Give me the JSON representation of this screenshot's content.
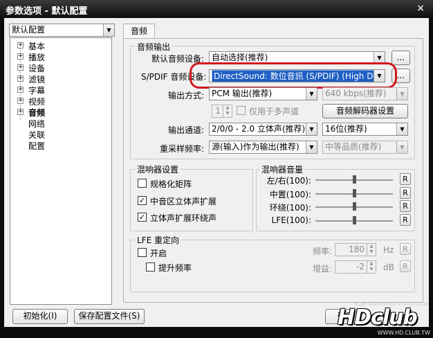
{
  "window": {
    "title": "参数选项 - 默认配置",
    "close_glyph": "×"
  },
  "profile_select": {
    "value": "默认配置"
  },
  "tree": {
    "items": [
      {
        "label": "基本",
        "expandable": true
      },
      {
        "label": "播放",
        "expandable": true
      },
      {
        "label": "设备",
        "expandable": true
      },
      {
        "label": "滤镜",
        "expandable": true
      },
      {
        "label": "字幕",
        "expandable": true
      },
      {
        "label": "视频",
        "expandable": true
      },
      {
        "label": "音频",
        "expandable": true,
        "selected": true
      },
      {
        "label": "网络",
        "expandable": false
      },
      {
        "label": "关联",
        "expandable": false
      },
      {
        "label": "配置",
        "expandable": false
      }
    ]
  },
  "tab": {
    "label": "音频"
  },
  "audio_output": {
    "group_label": "音频输出",
    "default_device_label": "默认音频设备:",
    "default_device_value": "自动选择(推荐)",
    "spdif_label": "S/PDIF 音频设备:",
    "spdif_value": "DirectSound: 数位音訊 (S/PDIF) (High Definition",
    "browse_label": "...",
    "output_mode_label": "输出方式:",
    "output_mode_value": "PCM 输出(推荐)",
    "bitrate_value": "640 kbps(推荐)",
    "spin_value": "1",
    "multichannel_only_label": "仅用于多声道",
    "decoder_button": "音频解码器设置",
    "channel_label": "输出通道:",
    "channel_value": "2/0/0 - 2.0 立体声(推荐)",
    "bits_value": "16位(推荐)",
    "resample_label": "重采样频率:",
    "resample_value": "源(输入)作为输出(推荐)",
    "quality_value": "中等品质(推荐)"
  },
  "mixer_settings": {
    "group_label": "混响器设置",
    "normalize_label": "规格化矩阵",
    "normalize_checked": false,
    "center_stereo_label": "中音区立体声扩展",
    "center_stereo_checked": true,
    "surround_label": "立体声扩展环绕声",
    "surround_checked": true
  },
  "mixer_volume": {
    "group_label": "混响器音量",
    "rows": [
      {
        "label": "左/右(100):",
        "level": 0.5,
        "reset": "R"
      },
      {
        "label": "中置(100):",
        "level": 0.5,
        "reset": "R"
      },
      {
        "label": "环绕(100):",
        "level": 0.5,
        "reset": "R"
      },
      {
        "label": "LFE(100):",
        "level": 0.5,
        "reset": "R"
      }
    ]
  },
  "lfe": {
    "group_label": "LFE 重定向",
    "enable_label": "开启",
    "enable_checked": false,
    "boost_label": "提升频率",
    "boost_checked": false,
    "freq_label": "频率:",
    "freq_value": "180",
    "freq_unit": "Hz",
    "gain_label": "增益:",
    "gain_value": "-2",
    "gain_unit": "dB",
    "reset": "R"
  },
  "footer": {
    "init_button": "初始化(I)",
    "save_button": "保存配置文件(S)",
    "ok_button": "确定",
    "watermark": "HDclub",
    "watermark_url": "WWW.HD.CLUB.TW",
    "watermark_tagline": "High Definition Vision Club"
  },
  "colors": {
    "highlight": "#d0161c",
    "selection": "#1f5fc5",
    "titlebar": "#1a1a1a"
  }
}
